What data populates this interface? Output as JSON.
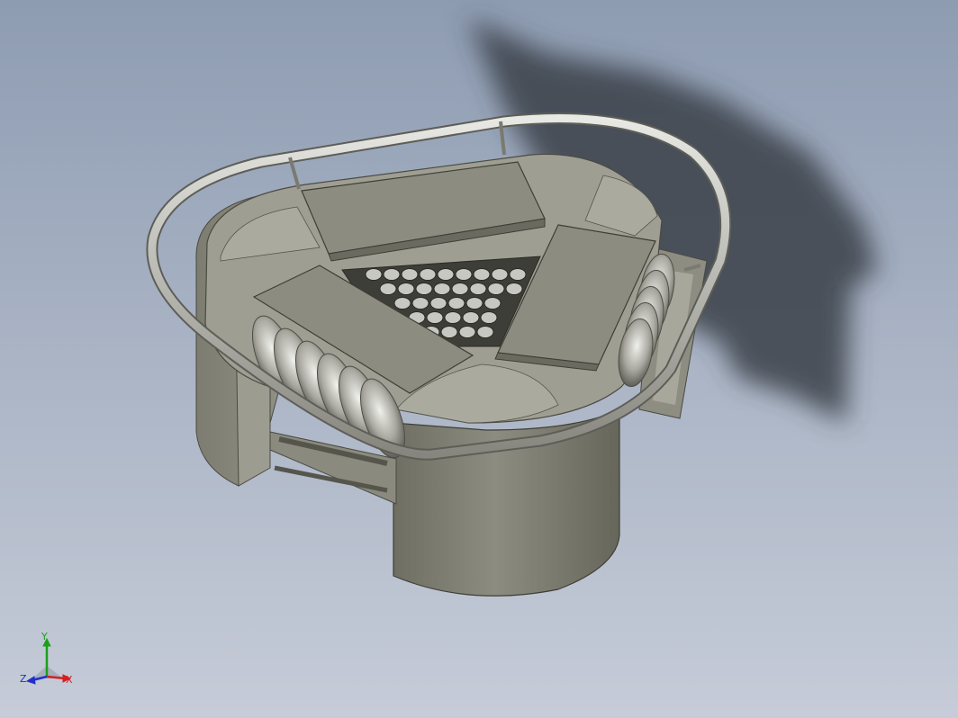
{
  "viewport": {
    "background_top": "#8e9cb2",
    "background_bottom": "#c6ccd8"
  },
  "model": {
    "body_color": "#7a7a6e",
    "rail_color": "#b8b8b0",
    "cover_color": "#8a8a7e"
  },
  "triad": {
    "y_label": "Y",
    "x_label": "X",
    "z_label": "Z",
    "y_color": "#1aa01a",
    "x_color": "#d42020",
    "z_color": "#2030c8"
  }
}
